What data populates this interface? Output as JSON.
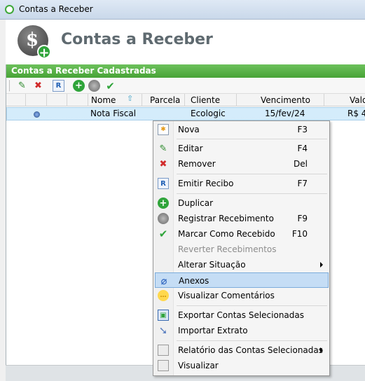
{
  "window": {
    "title": "Contas a Receber"
  },
  "header": {
    "title": "Contas a Receber"
  },
  "panel": {
    "title": "Contas a Receber Cadastradas"
  },
  "grid": {
    "columns": [
      "Nome",
      "Parcela",
      "Cliente",
      "Vencimento",
      "Valo"
    ],
    "row": {
      "nome": "Nota Fiscal",
      "cliente": "Ecologic",
      "vencimento": "15/fev/24",
      "valor": "R$ 4,"
    }
  },
  "menu": {
    "nova": "Nova",
    "nova_sc": "F3",
    "editar": "Editar",
    "editar_sc": "F4",
    "remover": "Remover",
    "remover_sc": "Del",
    "emitir": "Emitir Recibo",
    "emitir_sc": "F7",
    "duplicar": "Duplicar",
    "registrar": "Registrar Recebimento",
    "registrar_sc": "F9",
    "marcar": "Marcar Como Recebido",
    "marcar_sc": "F10",
    "reverter": "Reverter Recebimentos",
    "alterar": "Alterar Situação",
    "anexos": "Anexos",
    "comentarios": "Visualizar Comentários",
    "exportar": "Exportar Contas Selecionadas",
    "importar": "Importar Extrato",
    "relatorio": "Relatório das Contas Selecionadas",
    "visualizar": "Visualizar"
  },
  "icons": {
    "app": "green-circle-icon",
    "logo": "dollar-add-icon",
    "new": "new-document-icon",
    "edit": "edit-icon",
    "remove": "red-x-icon",
    "receipt": "receipt-r-icon",
    "add": "green-plus-icon",
    "register": "coin-gear-icon",
    "check": "green-check-icon",
    "attach": "paperclip-icon",
    "comment": "speech-bubble-icon",
    "export": "export-icon",
    "import": "import-icon",
    "report": "report-icon"
  },
  "colors": {
    "accent": "#47a336",
    "selection": "#c5ddf5",
    "row_selection": "#d4ecfb"
  }
}
